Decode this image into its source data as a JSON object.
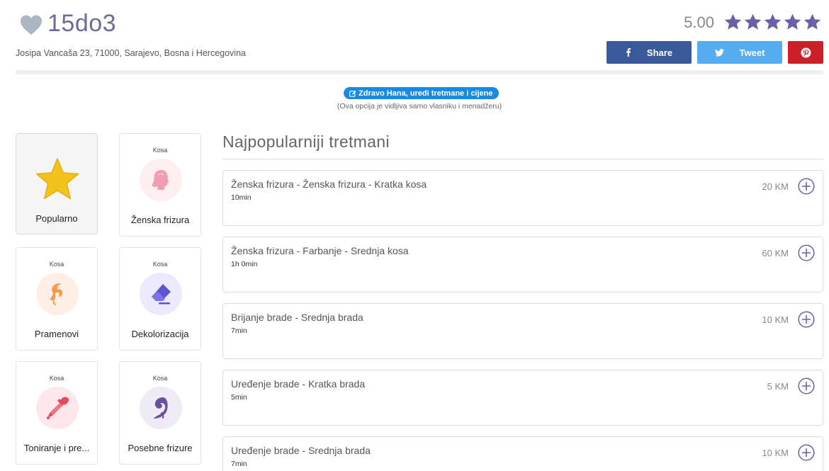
{
  "salon": {
    "name": "15do3",
    "address": "Josipa Vancaša 23, 71000, Sarajevo, Bosna i Hercegovina",
    "rating": "5.00",
    "stars": 5
  },
  "share": {
    "facebook_label": "Share",
    "twitter_label": "Tweet"
  },
  "owner_notice": {
    "edit_label": "Zdravo Hana, uredi tretmane i cijene",
    "note": "(Ova opcija je vidljiva samo vlasniku i menadžeru)"
  },
  "categories": [
    {
      "tag": "",
      "label": "Popularno",
      "icon": "star-icon"
    },
    {
      "tag": "Kosa",
      "label": "Ženska frizura",
      "icon": "woman-head-icon"
    },
    {
      "tag": "Kosa",
      "label": "Pramenovi",
      "icon": "hair-strand-icon"
    },
    {
      "tag": "Kosa",
      "label": "Dekolorizacija",
      "icon": "eraser-icon"
    },
    {
      "tag": "Kosa",
      "label": "Toniranje i pre...",
      "icon": "dropper-icon"
    },
    {
      "tag": "Kosa",
      "label": "Posebne frizure",
      "icon": "hair-curl-icon"
    }
  ],
  "section_title": "Najpopularniji tretmani",
  "treatments": [
    {
      "name": "Ženska frizura - Ženska frizura - Kratka kosa",
      "duration": "10min",
      "price": "20 KM"
    },
    {
      "name": "Ženska frizura - Farbanje - Srednja kosa",
      "duration": "1h 0min",
      "price": "60 KM"
    },
    {
      "name": "Brijanje brade - Srednja brada",
      "duration": "7min",
      "price": "10 KM"
    },
    {
      "name": "Uređenje brade - Kratka brada",
      "duration": "5min",
      "price": "5 KM"
    },
    {
      "name": "Uređenje brade - Srednja brada",
      "duration": "7min",
      "price": "10 KM"
    }
  ],
  "colors": {
    "accent": "#6b5fa8",
    "facebook": "#3b5998",
    "twitter": "#55acee",
    "pinterest": "#cb2027",
    "edit_pill": "#1a8ae0"
  }
}
